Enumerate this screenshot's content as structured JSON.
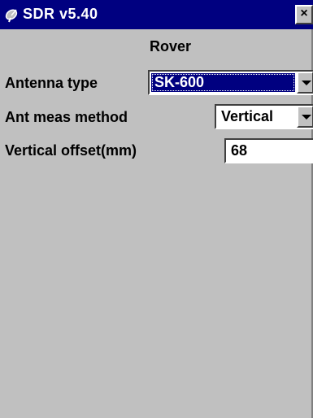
{
  "window": {
    "title": "SDR v5.40",
    "close_label": "×"
  },
  "form": {
    "heading": "Rover",
    "antenna_type": {
      "label": "Antenna type",
      "value": "SK-600"
    },
    "ant_meas_method": {
      "label": "Ant meas method",
      "value": "Vertical"
    },
    "vertical_offset": {
      "label": "Vertical offset(mm)",
      "value": "68"
    }
  },
  "icons": {
    "app": "satellite-dish-icon",
    "close": "close-icon",
    "dropdown": "chevron-down-icon"
  },
  "colors": {
    "titlebar": "#000080",
    "window_bg": "#c0c0c0",
    "selection": "#000080"
  }
}
